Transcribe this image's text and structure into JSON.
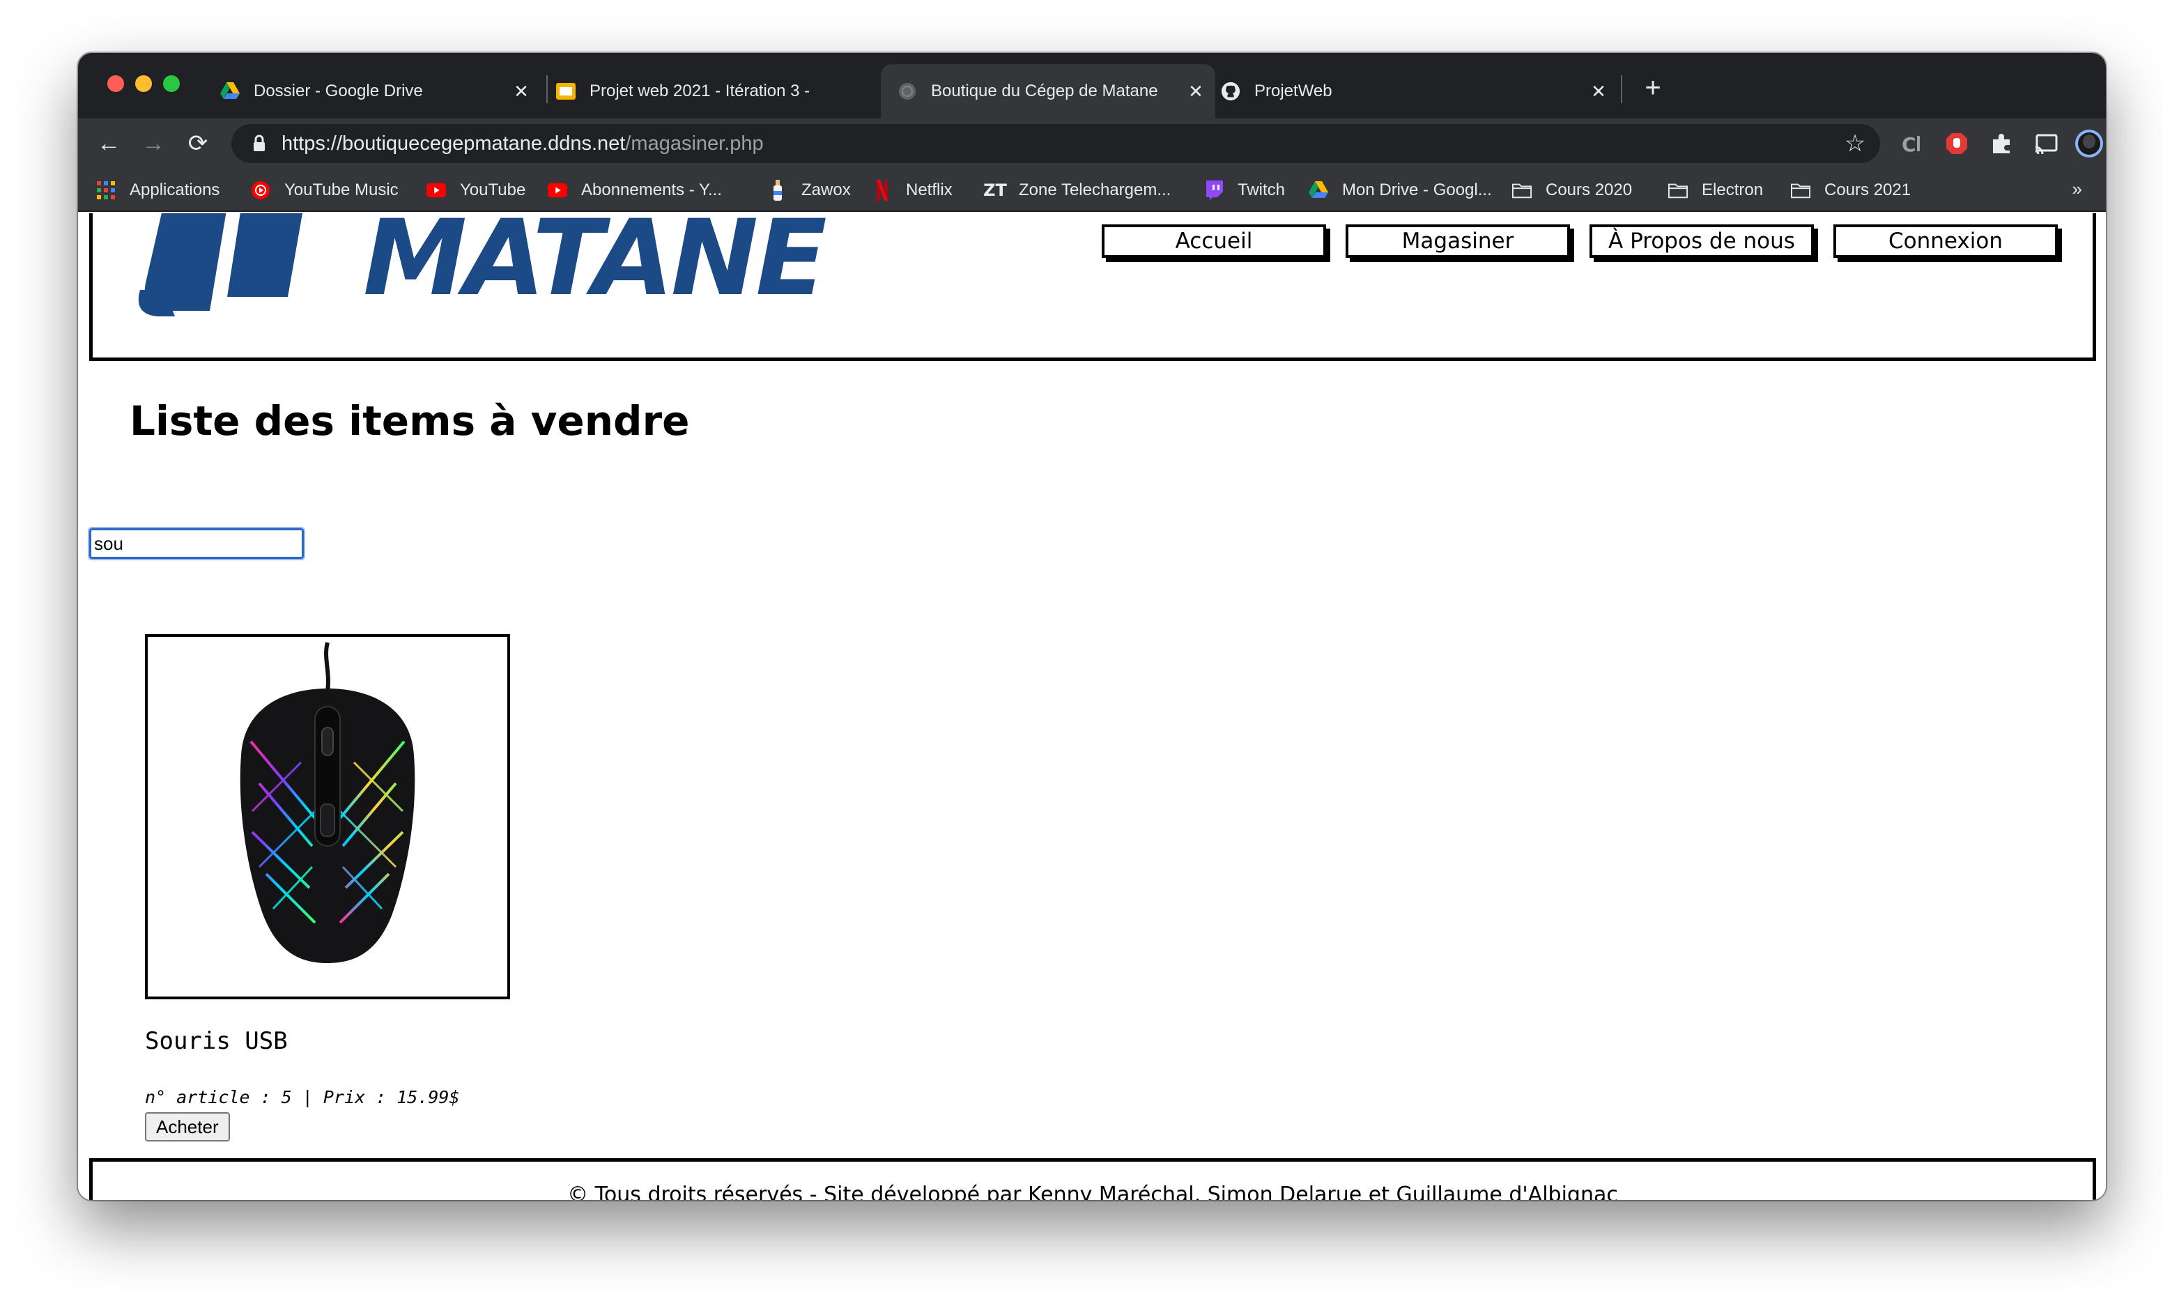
{
  "browser": {
    "tabs": [
      {
        "title": "Dossier - Google Drive",
        "icon": "google-drive-icon"
      },
      {
        "title": "Projet web 2021 - Itération 3 -",
        "icon": "google-slides-icon"
      },
      {
        "title": "Boutique du Cégep de Matane",
        "icon": "globe-icon",
        "active": true
      },
      {
        "title": "ProjetWeb",
        "icon": "github-icon"
      }
    ],
    "url_main": "https://boutiquecegepmatane.ddns.net",
    "url_path": "/magasiner.php",
    "bookmarks": [
      {
        "label": "Applications",
        "icon": "apps-grid-icon"
      },
      {
        "label": "YouTube Music",
        "icon": "youtube-music-icon"
      },
      {
        "label": "YouTube",
        "icon": "youtube-icon"
      },
      {
        "label": "Abonnements - Y...",
        "icon": "youtube-icon"
      },
      {
        "label": "Zawox",
        "icon": "bottle-icon"
      },
      {
        "label": "Netflix",
        "icon": "netflix-icon"
      },
      {
        "label": "Zone Telechargem...",
        "icon": "zt-icon"
      },
      {
        "label": "Twitch",
        "icon": "twitch-icon"
      },
      {
        "label": "Mon Drive - Googl...",
        "icon": "google-drive-icon"
      },
      {
        "label": "Cours 2020",
        "icon": "folder-icon"
      },
      {
        "label": "Electron",
        "icon": "folder-icon"
      },
      {
        "label": "Cours 2021",
        "icon": "folder-icon"
      }
    ],
    "bookmarks_more": "»"
  },
  "site": {
    "logo_text": "MATANE",
    "nav": {
      "home": "Accueil",
      "shop": "Magasiner",
      "about": "À Propos de nous",
      "login": "Connexion"
    },
    "page_title": "Liste des items à vendre",
    "search_value": "sou",
    "product": {
      "name": "Souris USB",
      "meta": "n° article : 5 | Prix : 15.99$",
      "buy_label": "Acheter"
    },
    "footer": "© Tous droits réservés - Site développé par Kenny Maréchal, Simon Delarue et Guillaume d'Albignac"
  },
  "colors": {
    "chrome_dark": "#202124",
    "chrome_toolbar": "#35363a",
    "logo_blue": "#1c4a86"
  }
}
